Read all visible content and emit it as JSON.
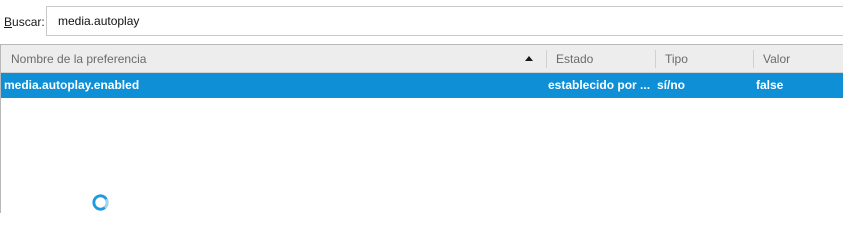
{
  "search": {
    "label_accel": "B",
    "label_rest": "uscar:",
    "value": "media.autoplay"
  },
  "table": {
    "columns": {
      "name": "Nombre de la preferencia",
      "state": "Estado",
      "type": "Tipo",
      "value": "Valor"
    },
    "rows": [
      {
        "name": "media.autoplay.enabled",
        "state": "establecido por ...",
        "type": "sí/no",
        "value": "false"
      }
    ]
  },
  "colors": {
    "selection": "#0e8fd6",
    "spinner": "#1f9ae0"
  }
}
